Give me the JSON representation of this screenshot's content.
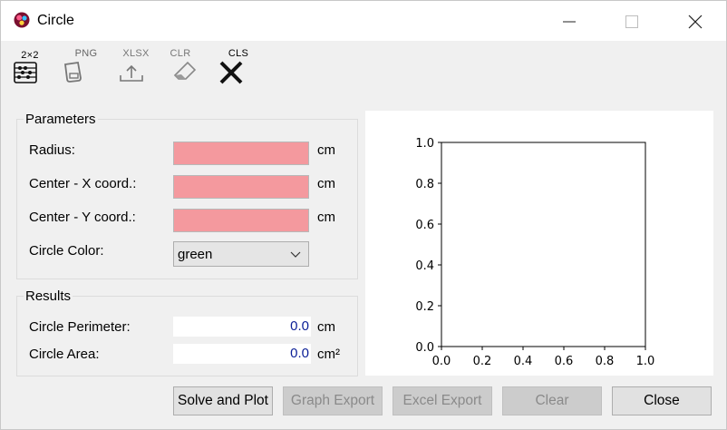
{
  "window": {
    "title": "Circle"
  },
  "toolbar": {
    "matrix_caption": "2×2",
    "png_caption": "PNG",
    "xlsx_caption": "XLSX",
    "clr_caption": "CLR",
    "cls_caption": "CLS"
  },
  "parameters": {
    "group_title": "Parameters",
    "radius_label": "Radius:",
    "radius_value": "",
    "radius_unit": "cm",
    "center_x_label": "Center - X coord.:",
    "center_x_value": "",
    "center_x_unit": "cm",
    "center_y_label": "Center - Y coord.:",
    "center_y_value": "",
    "center_y_unit": "cm",
    "color_label": "Circle Color:",
    "color_value": "green"
  },
  "results": {
    "group_title": "Results",
    "perimeter_label": "Circle Perimeter:",
    "perimeter_value": "0.0",
    "perimeter_unit": "cm",
    "area_label": "Circle Area:",
    "area_value": "0.0",
    "area_unit": "cm²"
  },
  "chart_data": {
    "type": "scatter",
    "series": [],
    "xlim": [
      0.0,
      1.0
    ],
    "ylim": [
      0.0,
      1.0
    ],
    "x_ticks": [
      "0.0",
      "0.2",
      "0.4",
      "0.6",
      "0.8",
      "1.0"
    ],
    "y_ticks": [
      "0.0",
      "0.2",
      "0.4",
      "0.6",
      "0.8",
      "1.0"
    ],
    "grid": false
  },
  "buttons": {
    "solve": "Solve and Plot",
    "graph_export": "Graph Export",
    "excel_export": "Excel Export",
    "clear": "Clear",
    "close": "Close"
  },
  "colors": {
    "invalid_input": "#f4999e",
    "readout_text": "#0a1e96",
    "window_bg": "#f0f0f0"
  }
}
